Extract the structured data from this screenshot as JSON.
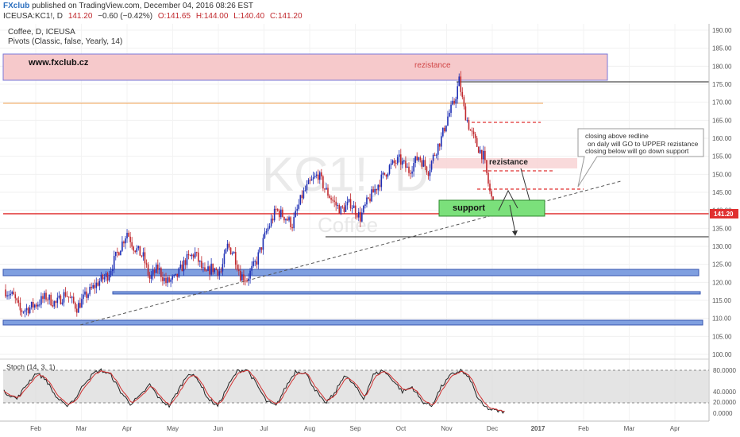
{
  "header": {
    "brand": "FXclub",
    "published": " published on TradingView.com, December 04, 2016 08:26 EST",
    "ticker": "ICEUSA:KC1!, D",
    "last": "141.20",
    "change": "−0.60 (−0.42%)",
    "ohlc_o": "O:141.65",
    "ohlc_h": "H:144.00",
    "ohlc_l": "L:140.40",
    "ohlc_c": "C:141.20",
    "symbol_line": "Coffee, D, ICEUSA",
    "indicator_line": "Pivots (Classic, false, Yearly, 14)"
  },
  "watermark": {
    "big": "KC1!, D",
    "small": "Coffee"
  },
  "annotations": {
    "site": "www.fxclub.cz",
    "top_zone": "rezistance",
    "mid_zone": "rezistance",
    "support": "support",
    "note_line1": "closing above redline",
    "note_line2": "on daly will GO to UPPER rezistance",
    "note_line3": "closing below will go down support"
  },
  "price_badge": "141.20",
  "stoch": {
    "label": "Stoch (14, 3, 1)",
    "ticks": [
      "80.0000",
      "40.0000",
      "20.0000",
      "0.0000"
    ]
  },
  "colors": {
    "up": "#1e2fb5",
    "down": "#c0282d",
    "redline": "#e03030",
    "support_fill": "#7be07b",
    "blue_zone": "#7f9fe0"
  },
  "chart_data": {
    "type": "candlestick",
    "y_ticks": [
      190,
      185,
      180,
      175,
      170,
      165,
      160,
      155,
      150,
      145,
      140,
      135,
      130,
      125,
      120,
      115,
      110,
      105,
      100
    ],
    "ylim": [
      100,
      190
    ],
    "x_ticks": [
      "Feb",
      "Mar",
      "Apr",
      "May",
      "Jun",
      "Jul",
      "Aug",
      "Sep",
      "Oct",
      "Nov",
      "Dec",
      "2017",
      "Feb",
      "Mar",
      "Apr"
    ],
    "price_path": [
      [
        0,
        118
      ],
      [
        6,
        116
      ],
      [
        10,
        112
      ],
      [
        16,
        113
      ],
      [
        20,
        114
      ],
      [
        26,
        116
      ],
      [
        32,
        114
      ],
      [
        38,
        117
      ],
      [
        45,
        113
      ],
      [
        50,
        116
      ],
      [
        58,
        120
      ],
      [
        64,
        122
      ],
      [
        70,
        128
      ],
      [
        76,
        134
      ],
      [
        80,
        130
      ],
      [
        86,
        127
      ],
      [
        90,
        121
      ],
      [
        95,
        124
      ],
      [
        100,
        120
      ],
      [
        106,
        121
      ],
      [
        112,
        126
      ],
      [
        118,
        128
      ],
      [
        124,
        122
      ],
      [
        128,
        124
      ],
      [
        134,
        123
      ],
      [
        138,
        130
      ],
      [
        142,
        128
      ],
      [
        146,
        122
      ],
      [
        150,
        121
      ],
      [
        156,
        126
      ],
      [
        162,
        134
      ],
      [
        168,
        140
      ],
      [
        174,
        138
      ],
      [
        178,
        136
      ],
      [
        184,
        144
      ],
      [
        188,
        147
      ],
      [
        194,
        150
      ],
      [
        198,
        146
      ],
      [
        204,
        142
      ],
      [
        208,
        140
      ],
      [
        214,
        142
      ],
      [
        220,
        138
      ],
      [
        224,
        142
      ],
      [
        228,
        145
      ],
      [
        232,
        148
      ],
      [
        238,
        152
      ],
      [
        244,
        154
      ],
      [
        250,
        151
      ],
      [
        256,
        155
      ],
      [
        262,
        151
      ],
      [
        266,
        156
      ],
      [
        270,
        160
      ],
      [
        274,
        166
      ],
      [
        278,
        170
      ],
      [
        281,
        176
      ],
      [
        284,
        168
      ],
      [
        288,
        162
      ],
      [
        292,
        158
      ],
      [
        296,
        155
      ],
      [
        298,
        150
      ],
      [
        300,
        145
      ],
      [
        302,
        141.2
      ]
    ],
    "stoch_path": [
      [
        0,
        45
      ],
      [
        8,
        30
      ],
      [
        14,
        60
      ],
      [
        20,
        85
      ],
      [
        26,
        70
      ],
      [
        32,
        35
      ],
      [
        38,
        15
      ],
      [
        44,
        30
      ],
      [
        50,
        65
      ],
      [
        56,
        85
      ],
      [
        60,
        90
      ],
      [
        66,
        80
      ],
      [
        72,
        45
      ],
      [
        78,
        20
      ],
      [
        84,
        35
      ],
      [
        90,
        60
      ],
      [
        96,
        30
      ],
      [
        102,
        15
      ],
      [
        108,
        50
      ],
      [
        114,
        85
      ],
      [
        120,
        70
      ],
      [
        126,
        30
      ],
      [
        132,
        15
      ],
      [
        138,
        55
      ],
      [
        144,
        88
      ],
      [
        150,
        92
      ],
      [
        156,
        60
      ],
      [
        162,
        25
      ],
      [
        168,
        15
      ],
      [
        174,
        55
      ],
      [
        180,
        88
      ],
      [
        186,
        85
      ],
      [
        192,
        50
      ],
      [
        198,
        20
      ],
      [
        204,
        40
      ],
      [
        210,
        80
      ],
      [
        216,
        60
      ],
      [
        222,
        30
      ],
      [
        228,
        80
      ],
      [
        234,
        90
      ],
      [
        240,
        70
      ],
      [
        246,
        45
      ],
      [
        252,
        55
      ],
      [
        258,
        25
      ],
      [
        264,
        15
      ],
      [
        270,
        55
      ],
      [
        276,
        80
      ],
      [
        282,
        90
      ],
      [
        288,
        70
      ],
      [
        292,
        35
      ],
      [
        296,
        15
      ],
      [
        300,
        8
      ],
      [
        304,
        5
      ],
      [
        308,
        3
      ]
    ]
  }
}
